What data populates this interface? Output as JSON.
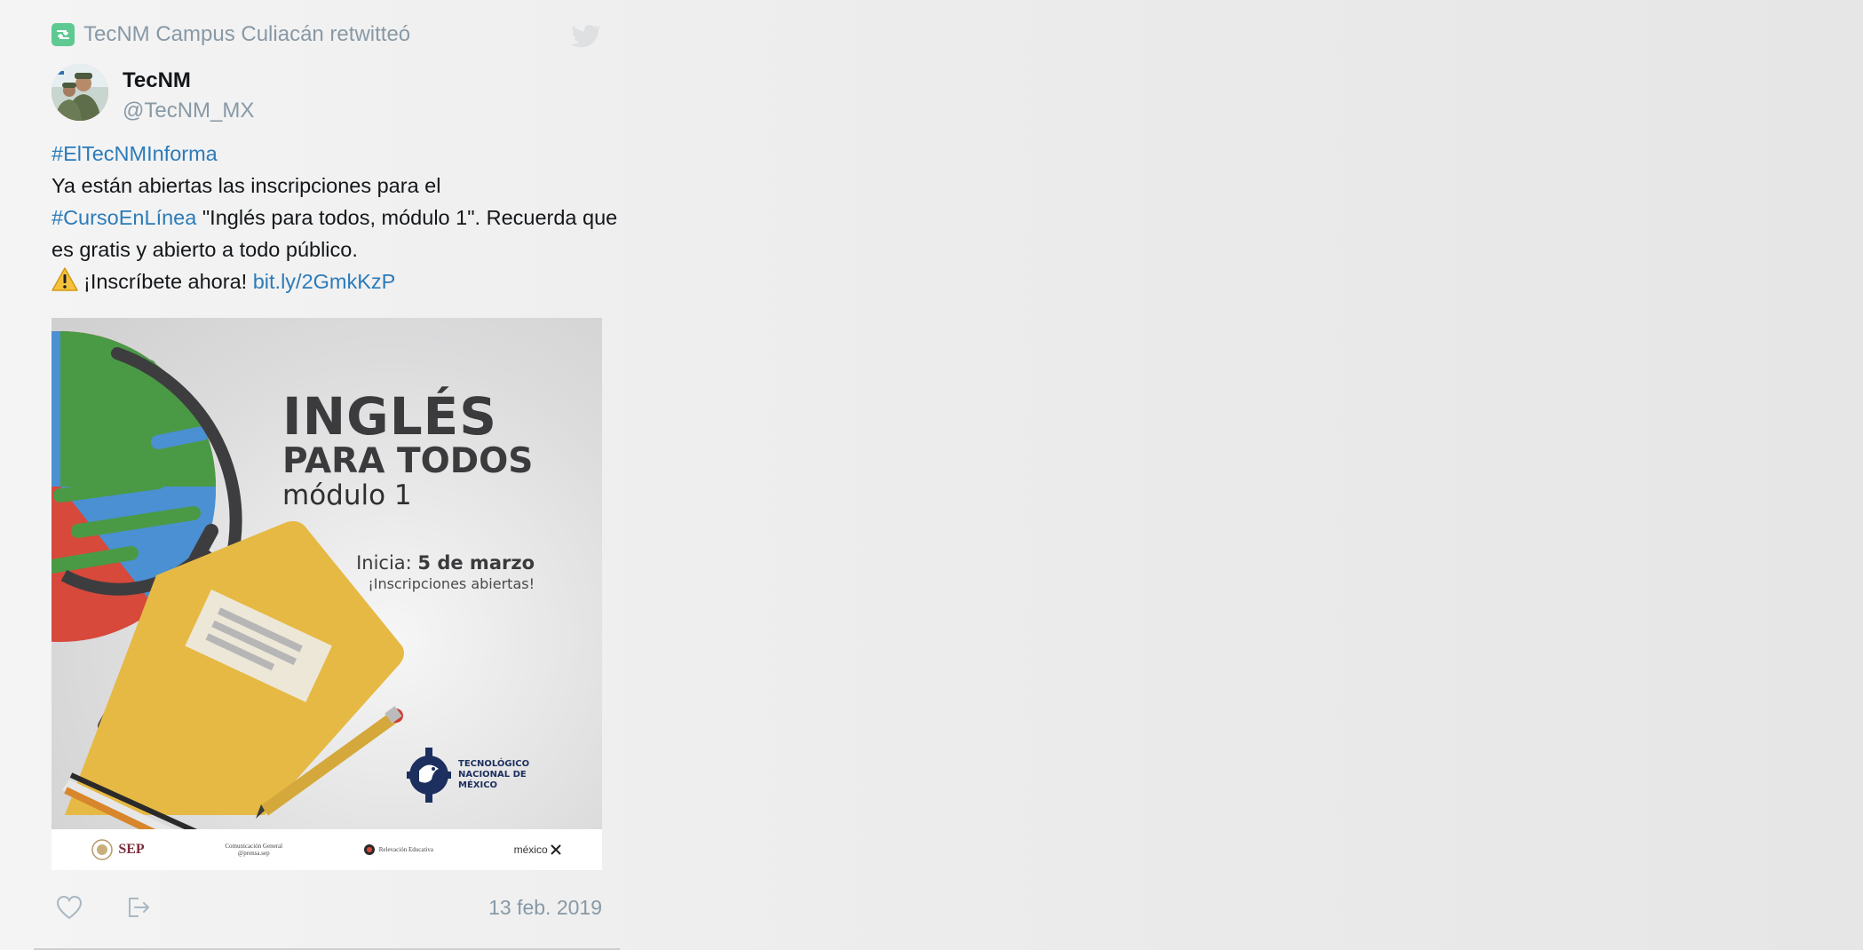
{
  "retweet": {
    "text": "TecNM Campus Culiacán retwitteó",
    "icon": "retweet-icon"
  },
  "author": {
    "display_name": "TecNM",
    "handle": "@TecNM_MX"
  },
  "tweet": {
    "hashtag_1": "#ElTecNMInforma",
    "line_1": "Ya están abiertas las inscripciones para el",
    "hashtag_2": "#CursoEnLínea",
    "line_2": " \"Inglés para todos, módulo 1\". Recuerda que es gratis y abierto a todo público.",
    "line_3": "¡Inscríbete ahora!",
    "link": "bit.ly/2GmkKzP",
    "emoji": "warning-icon"
  },
  "media": {
    "title": "INGLÉS",
    "subtitle": "PARA TODOS",
    "module": "módulo 1",
    "start_label": "Inicia:",
    "start_date": "5 de marzo",
    "open_text": "¡Inscripciones abiertas!",
    "logo_text": "Tecnológico Nacional de México",
    "footer": {
      "sep": "SEP",
      "comm_line_1": "Comunicación General",
      "comm_line_2": "@prensa.sep",
      "edu": "Relevación Educativa",
      "mexico": "méxico"
    },
    "colors": {
      "globe_blue": "#4a90d2",
      "globe_green": "#4a9a45",
      "globe_red": "#d6493b",
      "folder_yellow": "#e6b944",
      "dark": "#3b3b3d",
      "logo_navy": "#1d2f5e"
    }
  },
  "actions": {
    "like_icon": "heart-icon",
    "share_icon": "share-icon",
    "date": "13 feb. 2019"
  }
}
